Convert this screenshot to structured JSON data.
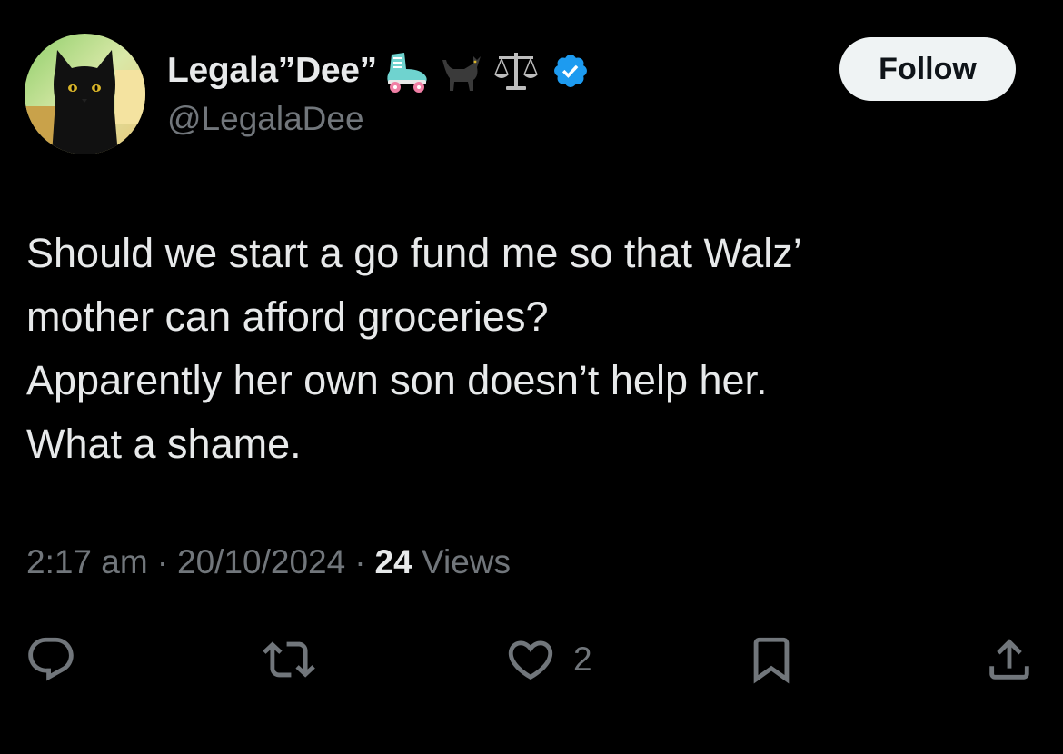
{
  "author": {
    "display_name": "Legala”Dee”",
    "handle": "@LegalaDee",
    "emojis": [
      "roller-skate-emoji",
      "black-cat-emoji",
      "scales-emoji"
    ],
    "verified": true,
    "verified_color": "#1d9bf0"
  },
  "follow_button": {
    "label": "Follow"
  },
  "tweet": {
    "lines": [
      "Should we start a go fund me so that Walz’",
      "mother can afford groceries?",
      "Apparently her own son doesn’t help her.",
      "What a shame."
    ]
  },
  "meta": {
    "time": "2:17 am",
    "separator": "·",
    "date": "20/10/2024",
    "views_count": "24",
    "views_label": "Views"
  },
  "actions": {
    "reply": {
      "icon": "reply-icon"
    },
    "retweet": {
      "icon": "retweet-icon"
    },
    "like": {
      "icon": "heart-icon",
      "count": "2"
    },
    "bookmark": {
      "icon": "bookmark-icon"
    },
    "share": {
      "icon": "share-icon"
    }
  },
  "colors": {
    "background": "#000000",
    "text": "#e7e9ea",
    "secondary": "#71767b",
    "button_bg": "#eff3f4",
    "button_text": "#0f1419"
  }
}
